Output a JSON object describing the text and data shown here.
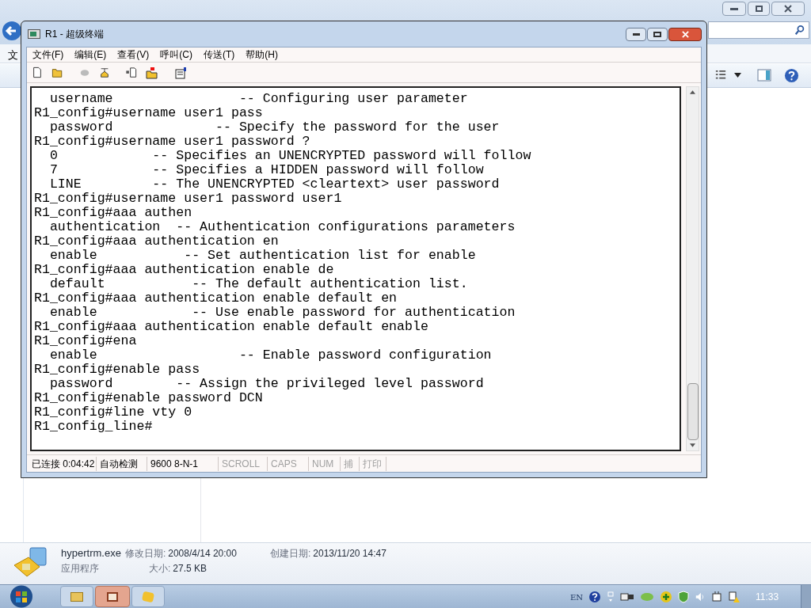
{
  "explorer": {
    "menu_partial": "文",
    "details": {
      "filename": "hypertrm.exe",
      "modified_label": "修改日期:",
      "modified": "2008/4/14 20:00",
      "created_label": "创建日期:",
      "created": "2013/11/20 14:47",
      "type": "应用程序",
      "size_label": "大小:",
      "size": "27.5 KB"
    }
  },
  "window": {
    "title": "R1 - 超级终端"
  },
  "menu": [
    "文件(F)",
    "编辑(E)",
    "查看(V)",
    "呼叫(C)",
    "传送(T)",
    "帮助(H)"
  ],
  "terminal_lines": [
    "  username                -- Configuring user parameter",
    "R1_config#username user1 pass",
    "  password             -- Specify the password for the user",
    "R1_config#username user1 password ?",
    "  0            -- Specifies an UNENCRYPTED password will follow",
    "  7            -- Specifies a HIDDEN password will follow",
    "  LINE         -- The UNENCRYPTED <cleartext> user password",
    "R1_config#username user1 password user1",
    "R1_config#aaa authen",
    "  authentication  -- Authentication configurations parameters",
    "R1_config#aaa authentication en",
    "  enable           -- Set authentication list for enable",
    "R1_config#aaa authentication enable de",
    "  default           -- The default authentication list.",
    "R1_config#aaa authentication enable default en",
    "  enable            -- Use enable password for authentication",
    "R1_config#aaa authentication enable default enable",
    "R1_config#ena",
    "  enable                  -- Enable password configuration",
    "R1_config#enable pass",
    "  password        -- Assign the privileged level password",
    "R1_config#enable password DCN",
    "R1_config#line vty 0",
    "R1_config_line#"
  ],
  "status_bar": [
    {
      "text": "已连接 0:04:42",
      "on": true
    },
    {
      "text": "自动检测",
      "on": true
    },
    {
      "text": "9600 8-N-1",
      "on": true
    },
    {
      "text": "SCROLL",
      "on": false
    },
    {
      "text": "CAPS",
      "on": false
    },
    {
      "text": "NUM",
      "on": false
    },
    {
      "text": "捕",
      "on": false
    },
    {
      "text": "打印",
      "on": false
    }
  ],
  "taskbar": {
    "language": "EN",
    "clock": "11:33"
  }
}
